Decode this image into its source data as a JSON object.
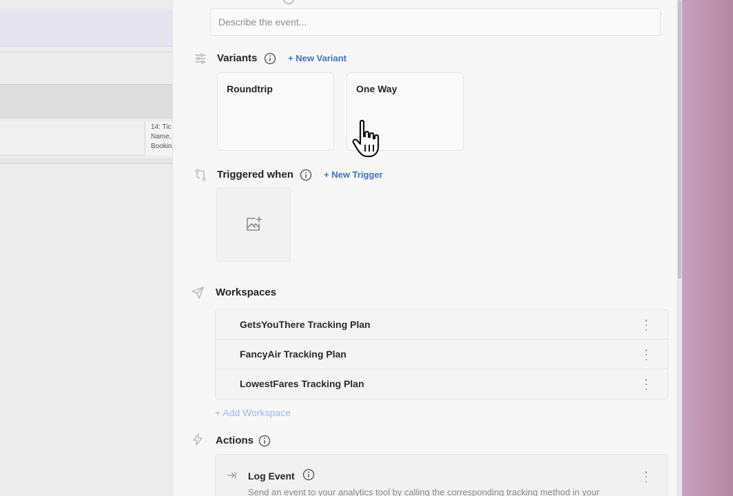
{
  "background_app": {
    "row_text_1": "14: Tic",
    "row_text_2": "Name,",
    "row_text_3": "Bookin"
  },
  "description": {
    "placeholder": "Describe the event..."
  },
  "variants": {
    "title": "Variants",
    "new_label": "+ New Variant",
    "items": [
      {
        "label": "Roundtrip"
      },
      {
        "label": "One Way"
      }
    ]
  },
  "triggers": {
    "title": "Triggered when",
    "new_label": "+ New Trigger",
    "image_icon": "image-add-icon"
  },
  "workspaces": {
    "title": "Workspaces",
    "items": [
      {
        "name": "GetsYouThere Tracking Plan"
      },
      {
        "name": "FancyAir Tracking Plan"
      },
      {
        "name": "LowestFares Tracking Plan"
      }
    ],
    "add_label": "+ Add Workspace"
  },
  "actions": {
    "title": "Actions",
    "items": [
      {
        "title": "Log Event",
        "description": "Send an event to your analytics tool by calling the corresponding tracking method in your"
      }
    ]
  },
  "colors": {
    "accent": "#3e72c4",
    "accent_muted": "#9cbbe4",
    "backdrop": "#c7a2c0"
  }
}
